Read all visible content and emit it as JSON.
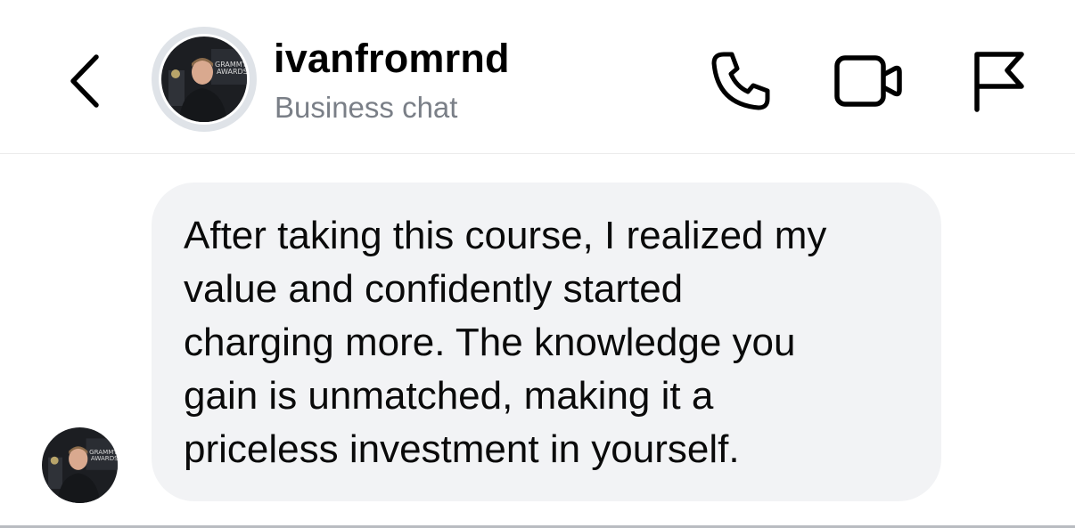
{
  "header": {
    "username": "ivanfromrnd",
    "subtitle": "Business chat",
    "icons": {
      "back": "chevron-left-icon",
      "call": "phone-icon",
      "video": "video-camera-icon",
      "report": "flag-icon"
    }
  },
  "avatar": {
    "backdrop_text": [
      "GRAMMY",
      "AWARDS"
    ],
    "small_backdrop_text": [
      "GRAMMY",
      "AWARDS"
    ]
  },
  "message": {
    "lines": [
      "After taking this course, I realized my",
      "value and confidently started",
      "charging more. The knowledge you",
      "gain is unmatched, making it a",
      "priceless investment in yourself."
    ]
  },
  "colors": {
    "bubble_bg": "#f2f3f5",
    "subtitle": "#7a7f87",
    "divider": "#ececec"
  }
}
